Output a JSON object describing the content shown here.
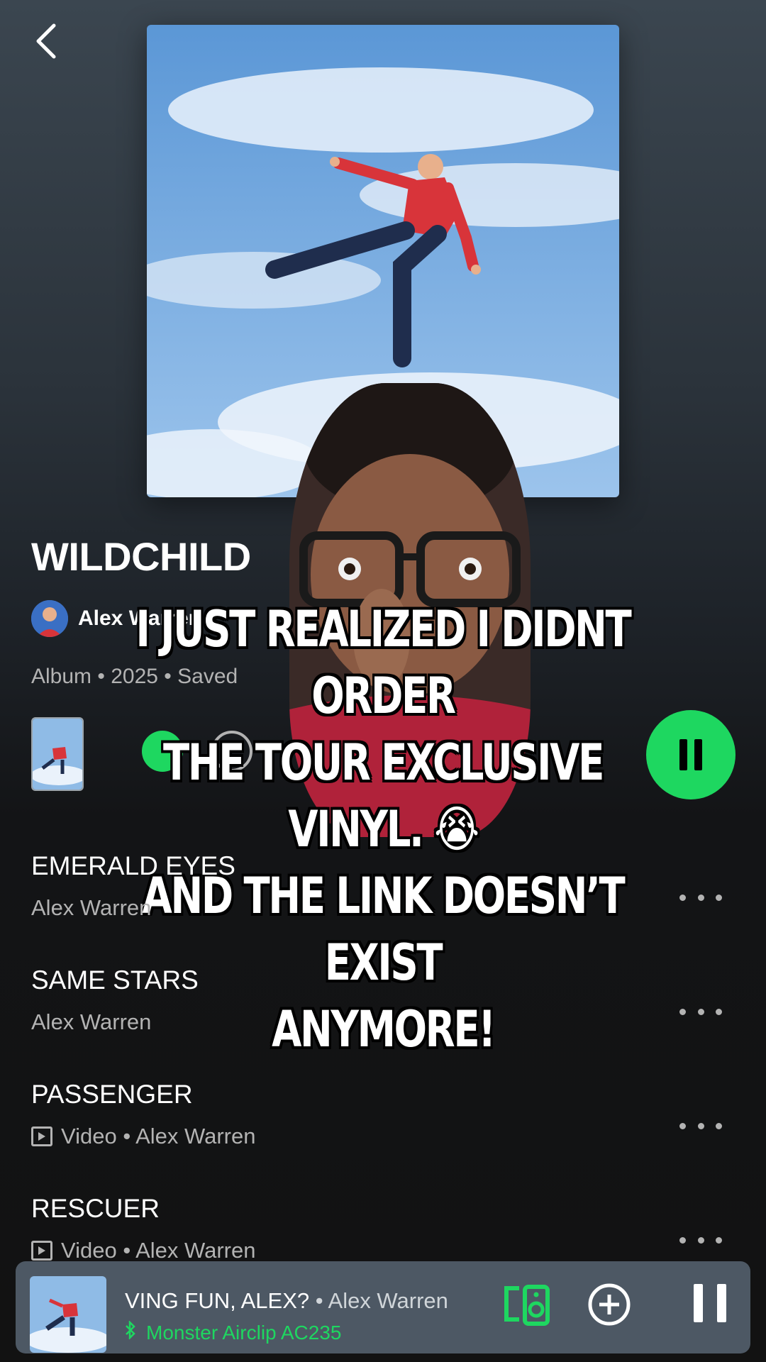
{
  "album": {
    "title": "WILDCHILD",
    "artist": "Alex Warren",
    "meta": "Album • 2025 • Saved",
    "art_colors": {
      "sky": "#6fa6de",
      "shirt": "#d8343a",
      "jeans": "#1f2d4d"
    }
  },
  "caption": {
    "text": "I JUST REALIZED I DIDNT ORDER\nTHE TOUR EXCLUSIVE VINYL. 😭\nAND THE LINK DOESN’T EXIST\nANYMORE!"
  },
  "tracks": [
    {
      "title": "EMERALD EYES",
      "subtitle": "Alex Warren",
      "video": false
    },
    {
      "title": "SAME STARS",
      "subtitle": "Alex Warren",
      "video": false
    },
    {
      "title": "PASSENGER",
      "subtitle": "Video • Alex Warren",
      "video": true
    },
    {
      "title": "RESCUER",
      "subtitle": "Video • Alex Warren",
      "video": true
    }
  ],
  "now_playing": {
    "title": "VING FUN, ALEX?",
    "separator": " • ",
    "artist": "Alex Warren",
    "device": "Monster Airclip AC235"
  },
  "icons": {
    "back": "chevron-left-icon",
    "more": "more-dots-icon",
    "devices": "devices-icon",
    "add": "add-circle-icon",
    "pause": "pause-icon",
    "bluetooth": "bluetooth-icon"
  },
  "colors": {
    "accent": "#1ed760",
    "background": "#121212",
    "mini_player": "#4d5864"
  }
}
